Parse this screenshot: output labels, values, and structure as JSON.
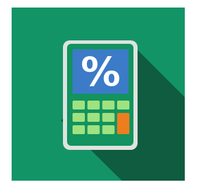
{
  "icon": {
    "name": "percentage-calculator-icon",
    "symbol": "%",
    "colors": {
      "background": "#139467",
      "long_shadow": "#0f5c40",
      "body_outline": "#dfe3df",
      "body_fill": "#12935f",
      "screen": "#3c7bc7",
      "symbol": "#ffffff",
      "keys": "#a0e27f",
      "equals_key": "#ee7d1d"
    },
    "key_grid": {
      "rows": 3,
      "columns": 4
    }
  }
}
